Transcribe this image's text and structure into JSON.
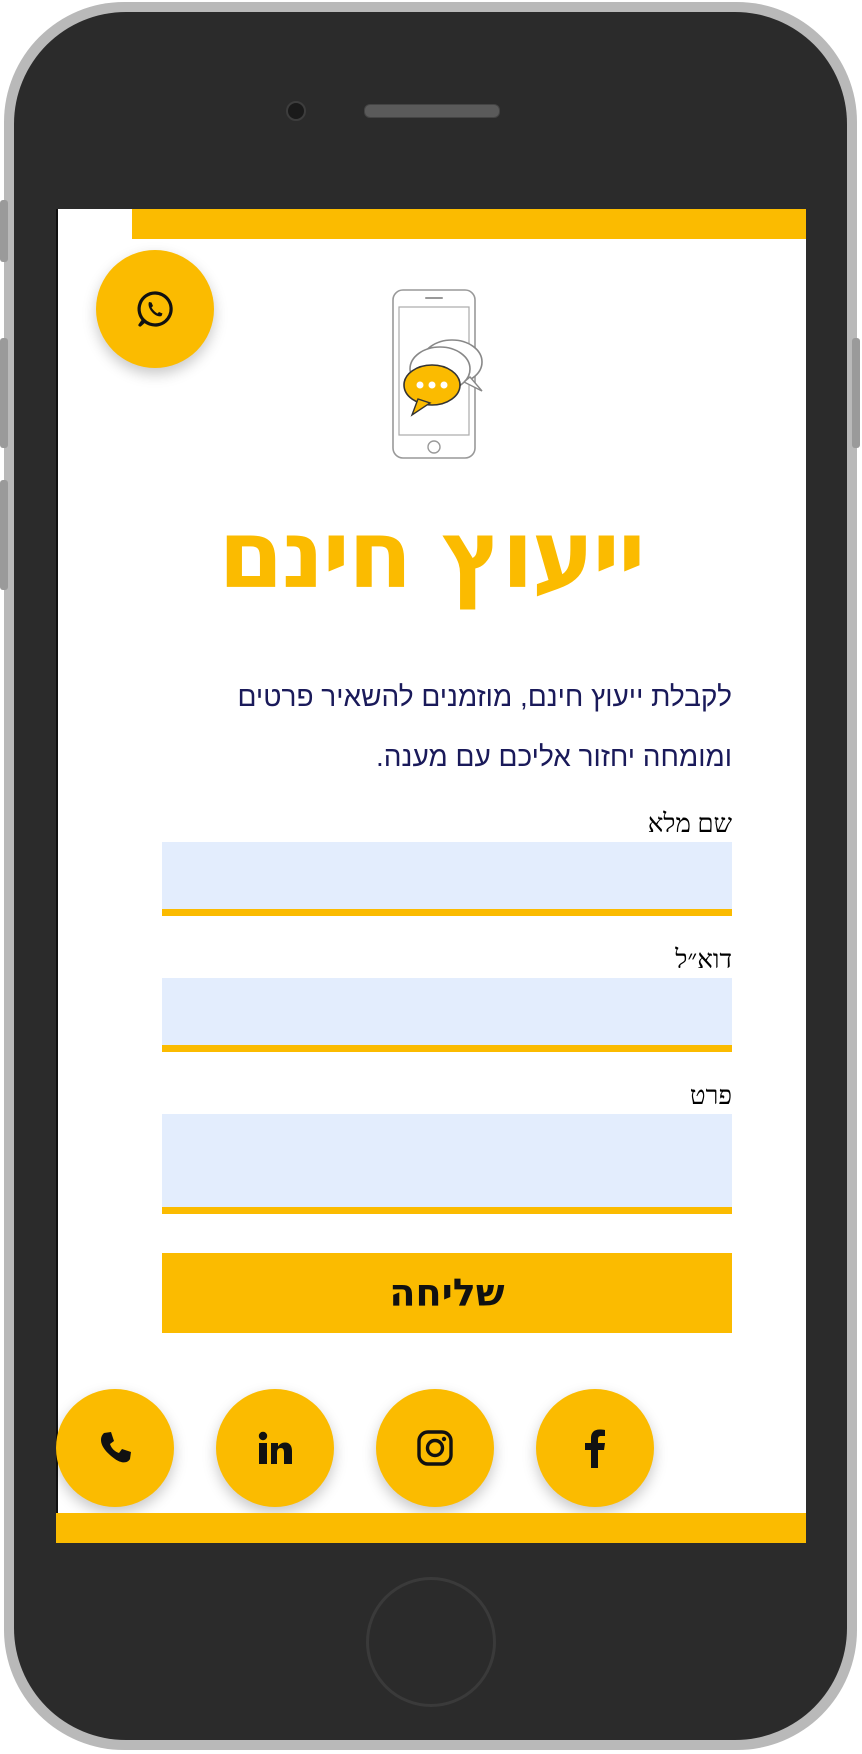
{
  "colors": {
    "accent": "#fbbb00",
    "field_bg": "#e3edfd",
    "intro_text": "#1a1a5a"
  },
  "page": {
    "title": "ייעוץ חינם",
    "intro": "לקבלת ייעוץ חינם, מוזמנים להשאיר פרטים ומומחה יחזור אליכם עם מענה."
  },
  "form": {
    "name_label": "שם מלא",
    "name_value": "",
    "email_label": "דוא״ל",
    "email_value": "",
    "detail_label": "פרט",
    "detail_value": "",
    "submit_label": "שליחה"
  },
  "icons": {
    "whatsapp": "whatsapp-icon",
    "hero": "phone-chat-illustration",
    "social": [
      "phone-icon",
      "linkedin-icon",
      "instagram-icon",
      "facebook-icon"
    ]
  }
}
